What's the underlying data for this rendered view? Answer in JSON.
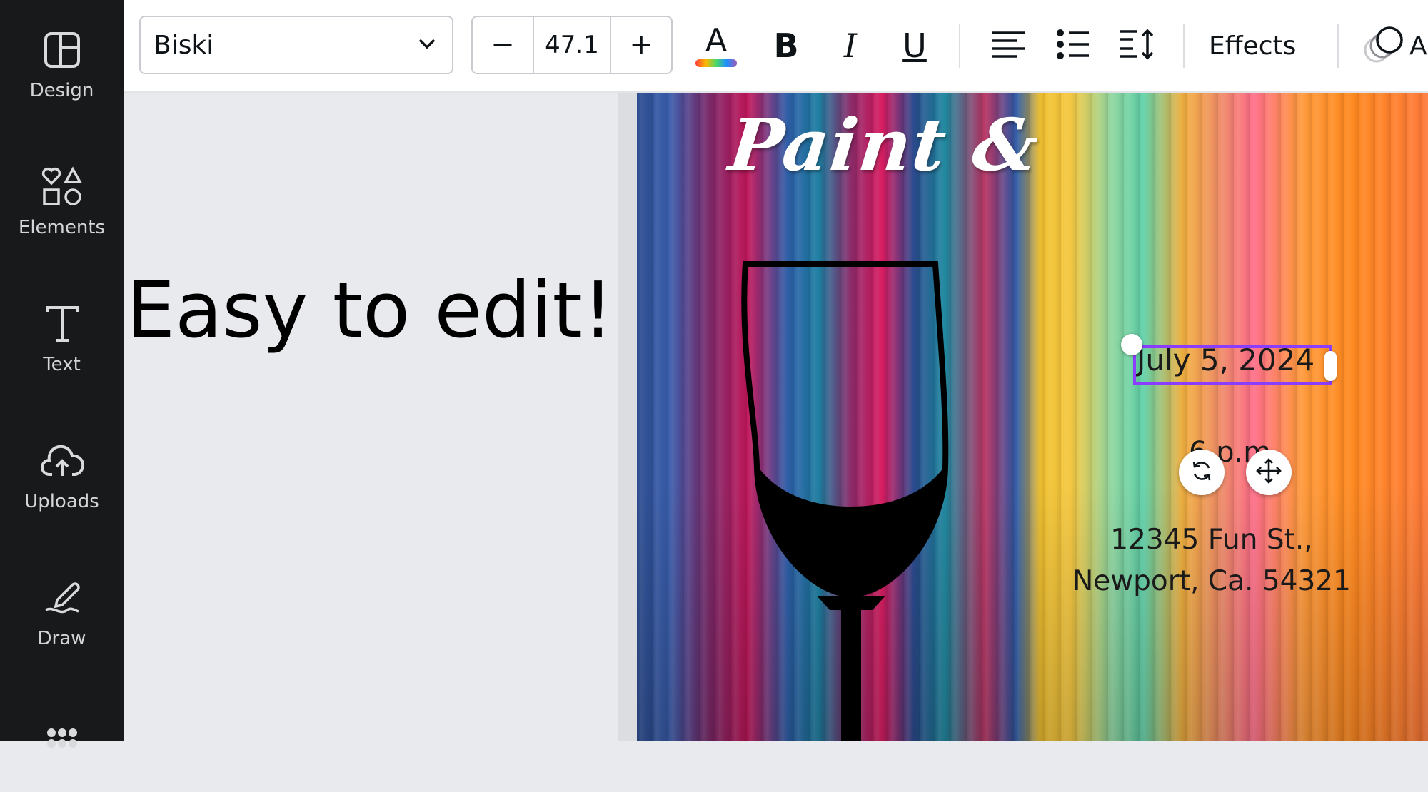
{
  "sidebar": {
    "items": [
      {
        "label": "Design",
        "icon": "layout-icon"
      },
      {
        "label": "Elements",
        "icon": "shapes-icon"
      },
      {
        "label": "Text",
        "icon": "text-icon"
      },
      {
        "label": "Uploads",
        "icon": "cloud-upload-icon"
      },
      {
        "label": "Draw",
        "icon": "draw-icon"
      },
      {
        "label": "",
        "icon": "apps-icon"
      }
    ]
  },
  "toolbar": {
    "font_family": "Biski",
    "font_size": "47.1",
    "decrease_label": "−",
    "increase_label": "+",
    "color_glyph": "A",
    "effects_label": "Effects",
    "animate_glyph": "A"
  },
  "canvas": {
    "hint_text": "Easy to edit!",
    "title_text": "Paint &",
    "date_text": "July 5, 2024",
    "time_text": "6 p.m.",
    "address_line1": "12345 Fun St.,",
    "address_line2": "Newport, Ca. 54321"
  },
  "colors": {
    "sidebar_bg": "#18191b",
    "selection": "#8b3dff",
    "canvas_bg": "#e9eaee"
  }
}
